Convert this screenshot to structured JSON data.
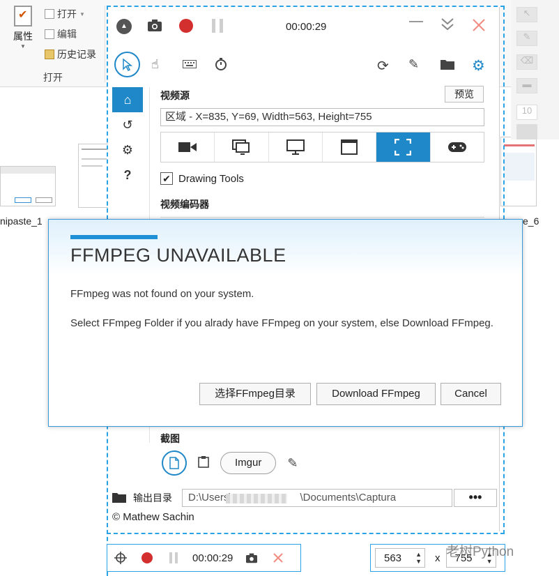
{
  "explorer": {
    "ribbon": {
      "properties_label": "属性",
      "open_label": "打开",
      "edit_label": "编辑",
      "history_label": "历史记录",
      "group_label": "打开"
    },
    "files": [
      {
        "name": "nipaste_1"
      },
      {
        "name": "e_6"
      }
    ],
    "right_tool_value": "10"
  },
  "captura": {
    "timer": "00:00:29",
    "source_title": "视频源",
    "preview_label": "预览",
    "region_value": "区域 - X=835, Y=69, Width=563, Height=755",
    "drawing_tools_label": "Drawing Tools",
    "drawing_tools_checked": true,
    "encoder_title": "视频编码器",
    "screenshot_title": "截图",
    "imgur_label": "Imgur",
    "output_label": "输出目录",
    "output_path_start": "D:\\Users\\",
    "output_path_end": "\\Documents\\Captura",
    "more_label": "•••",
    "copyright": "© Mathew Sachin",
    "accent_color": "#1e88c8"
  },
  "dialog": {
    "title": "FFMPEG UNAVAILABLE",
    "message1": "FFmpeg was not found on your system.",
    "message2": "Select FFmpeg Folder if you alrady have FFmpeg on your system, else Download FFmpeg.",
    "select_folder_label": "选择FFmpeg目录",
    "download_label": "Download FFmpeg",
    "cancel_label": "Cancel"
  },
  "mini_bar": {
    "timer": "00:00:29"
  },
  "size_bar": {
    "width_value": "563",
    "separator": "x",
    "height_value": "755"
  },
  "watermark": "老树Python"
}
